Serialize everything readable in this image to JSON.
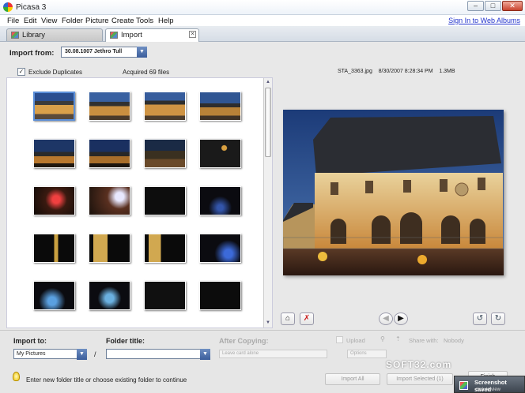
{
  "window": {
    "title": "Picasa 3",
    "controls": [
      "–",
      "□",
      "✕"
    ]
  },
  "menu": [
    "File",
    "Edit",
    "View",
    "Folder",
    "Picture",
    "Create",
    "Tools",
    "Help"
  ],
  "signin_link": "Sign In to Web Albums",
  "tabs": [
    {
      "label": "Library"
    },
    {
      "label": "Import"
    }
  ],
  "import_from": {
    "label": "Import from:",
    "value": "30.08.1007 Jethro Tull"
  },
  "exclude_duplicates": {
    "label": "Exclude Duplicates",
    "checked": true
  },
  "acquired": "Acquired 69 files",
  "file_info": {
    "name": "STA_3363.jpg",
    "date": "8/30/2007 8:28:34 PM",
    "size": "1.3MB"
  },
  "bottom": {
    "import_to_label": "Import to:",
    "import_to_value": "My Pictures",
    "slash": "/",
    "folder_title_label": "Folder title:",
    "folder_title_value": "",
    "after_copying_label": "After Copying:",
    "after_copying_value": "Leave card alone",
    "upload_label": "Upload",
    "share_with_label": "Share with:",
    "share_with_value": "Nobody",
    "options_label": "Options",
    "hint": "Enter new folder title or choose existing folder to continue",
    "import_all": "Import All",
    "import_selected": "Import Selected (1)",
    "finish": "Finish"
  },
  "watermark": "SOFT32.com",
  "toast": {
    "title": "Screenshot saved",
    "subtitle": "click to view"
  },
  "colors": {
    "accent": "#3a5d9b",
    "link": "#2233cc"
  }
}
